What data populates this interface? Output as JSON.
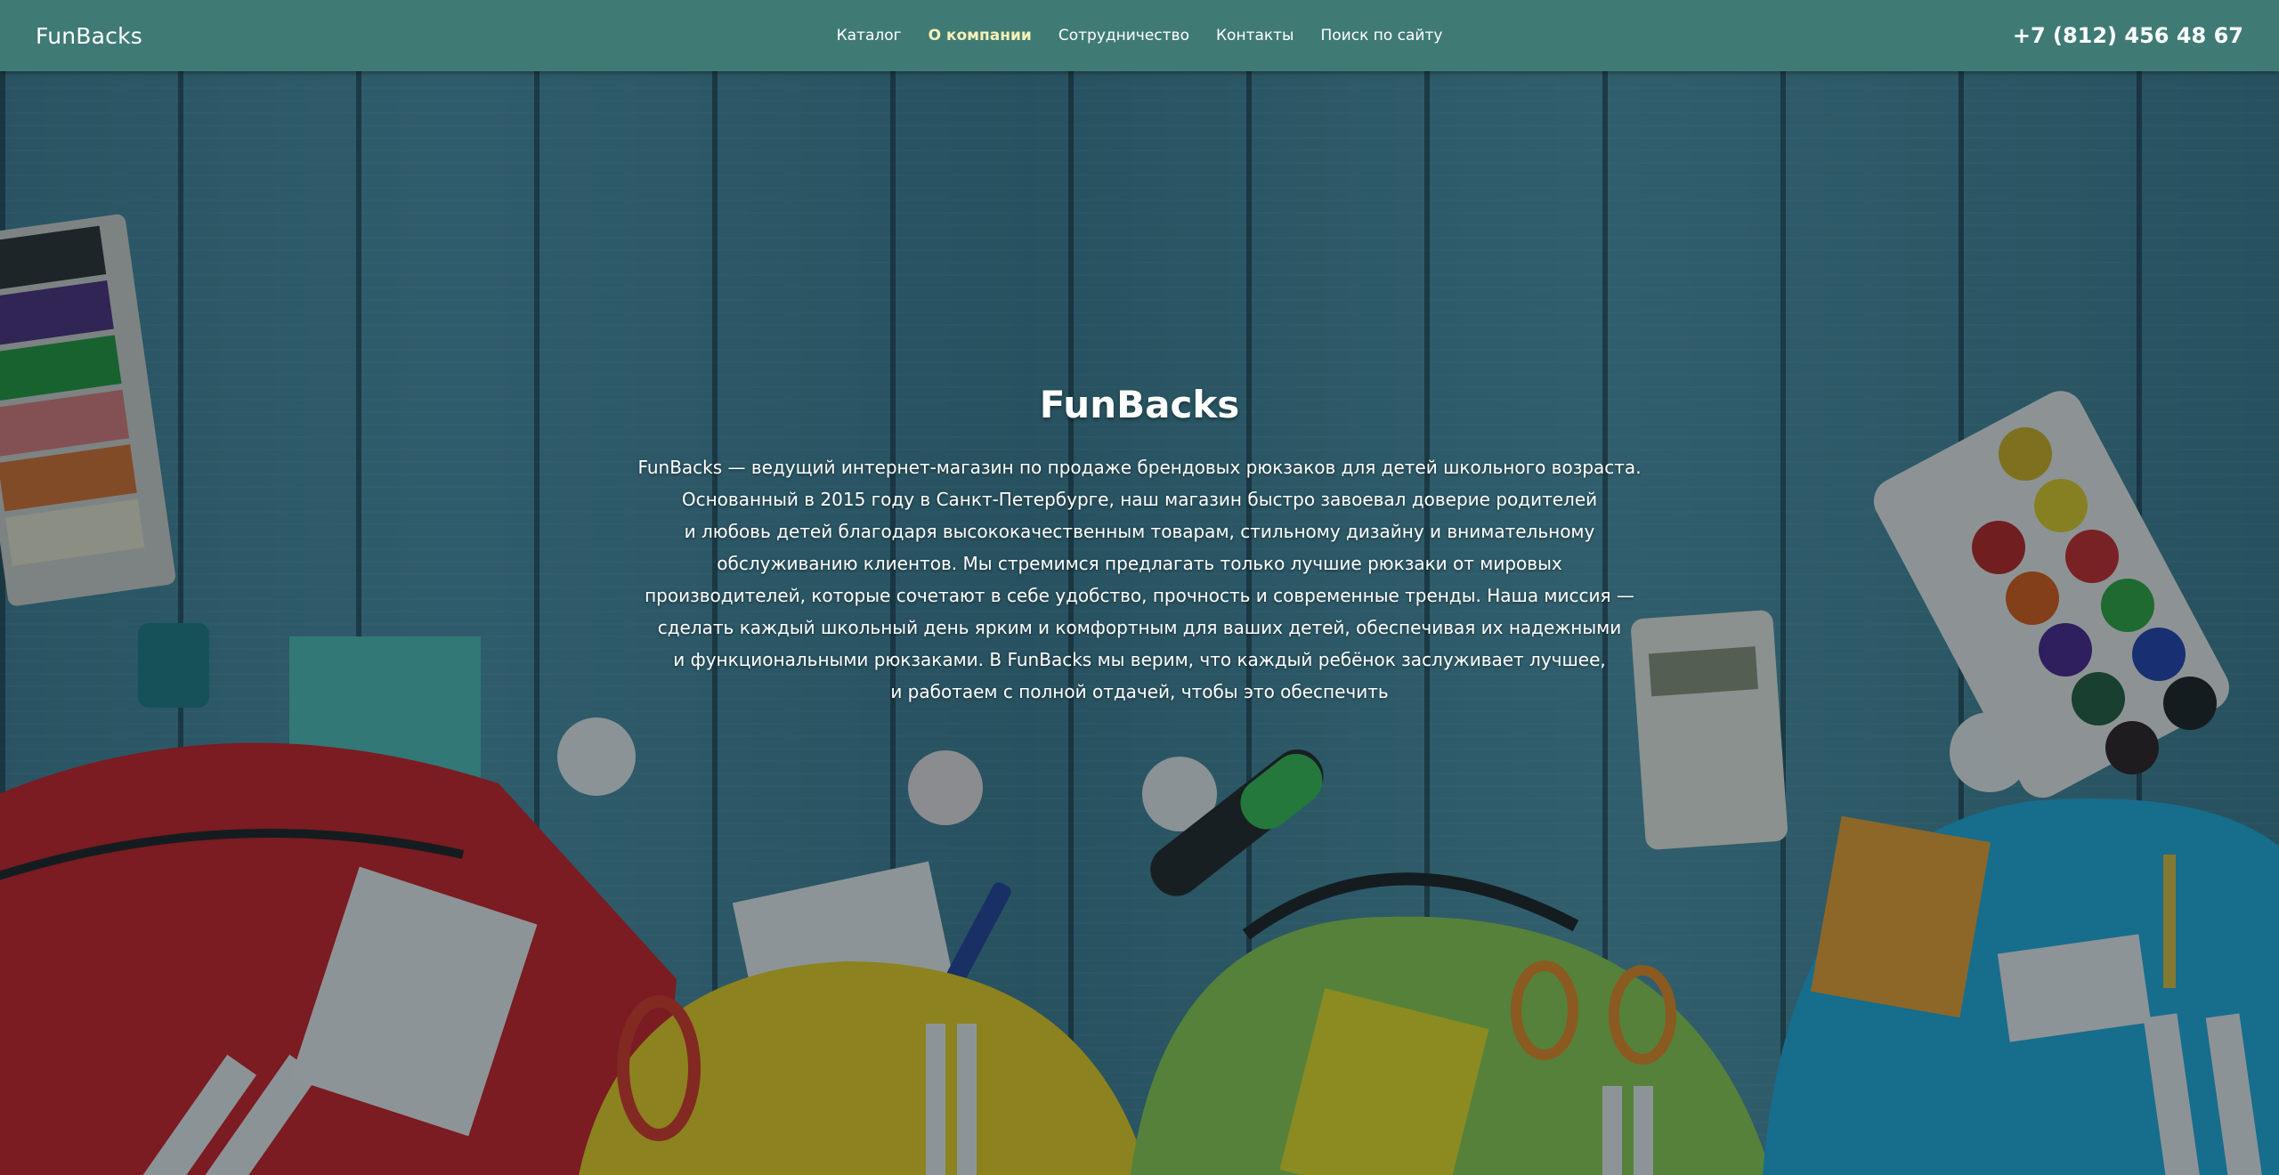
{
  "header": {
    "logo": "FunBacks",
    "nav": [
      {
        "label": "Каталог",
        "active": false
      },
      {
        "label": "О компании",
        "active": true
      },
      {
        "label": "Сотрудничество",
        "active": false
      },
      {
        "label": "Контакты",
        "active": false
      },
      {
        "label": "Поиск по сайту",
        "active": false
      }
    ],
    "phone": "+7 (812) 456 48 67"
  },
  "hero": {
    "title": "FunBacks",
    "lines": [
      "FunBacks — ведущий интернет-магазин по продаже брендовых рюкзаков для детей школьного возраста.",
      "Основанный в 2015 году в Санкт-Петербурге, наш магазин быстро завоевал доверие родителей",
      "и любовь детей благодаря высококачественным товарам, стильному дизайну и внимательному",
      "обслуживанию клиентов. Мы стремимся предлагать только лучшие рюкзаки от мировых",
      "производителей, которые сочетают в себе удобство, прочность и современные тренды. Наша миссия —",
      "сделать каждый школьный день ярким и комфортным для ваших детей, обеспечивая их надежными",
      "и функциональными рюкзаками. В FunBacks мы верим, что каждый ребёнок заслуживает лучшее,",
      "и работаем с полной отдачей, чтобы это обеспечить"
    ],
    "background_image": "school-backpacks-on-blue-wooden-table"
  },
  "colors": {
    "header_bg": "#3f7b74",
    "active_nav": "#f6f1b9",
    "text": "#ffffff"
  }
}
